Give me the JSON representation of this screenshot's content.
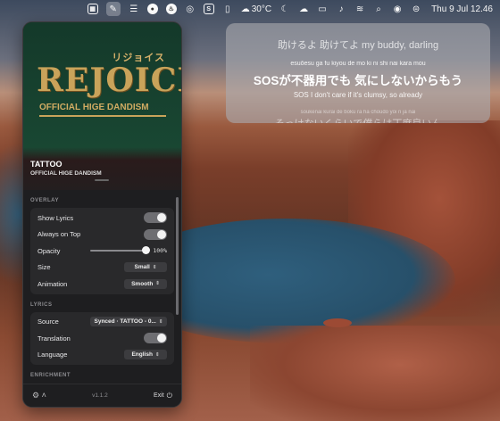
{
  "menubar": {
    "icons": [
      "square-icon",
      "wand-icon",
      "stack-icon",
      "github-icon",
      "fire-icon",
      "compass-icon",
      "s-app-icon",
      "battery-icon",
      "cloud-icon",
      "moon-icon",
      "cloud-fog-icon",
      "display-icon",
      "speaker-icon",
      "wifi-icon",
      "search-icon",
      "siri-icon",
      "control-center-icon"
    ],
    "temperature": "30°C",
    "datetime": "Thu 9 Jul  12.46"
  },
  "lyrics": {
    "previous": "助けるよ 助けてよ my buddy, darling",
    "current_romaji": "esuōesu ga fu kiyou de mo ki ni shi nai kara mou",
    "current": "SOSが不器用でも 気にしないからもう",
    "current_translation": "SOS I don't care if it's clumsy, so already",
    "next_romaji": "soukenai kurai de boku ra ha chōudo yoi n ja nai",
    "next": "そっけないくらいで僕らは丁度良いん"
  },
  "album": {
    "title_jp": "リジョイス",
    "title": "REJOICE",
    "artist": "OFFICIAL HIGE DANDISM"
  },
  "now_playing": {
    "track": "TATTOO",
    "artist": "OFFICIAL HIGE DANDISM"
  },
  "overlay": {
    "section": "OVERLAY",
    "show_lyrics_label": "Show Lyrics",
    "always_on_top_label": "Always on Top",
    "opacity_label": "Opacity",
    "opacity_value": "100%",
    "size_label": "Size",
    "size_value": "Small",
    "animation_label": "Animation",
    "animation_value": "Smooth"
  },
  "lyrics_settings": {
    "section": "LYRICS",
    "source_label": "Source",
    "source_value": "Synced · TATTOO - 0...",
    "translation_label": "Translation",
    "language_label": "Language",
    "language_value": "English"
  },
  "enrichment": {
    "section": "ENRICHMENT"
  },
  "footer": {
    "version": "v1.1.2",
    "exit_label": "Exit"
  }
}
